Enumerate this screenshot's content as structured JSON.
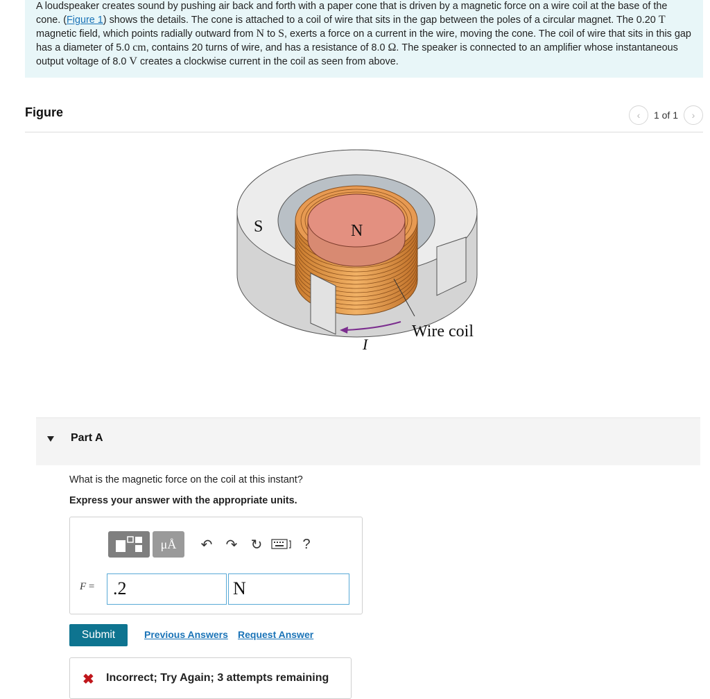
{
  "problem": {
    "s1": "A loudspeaker creates sound by pushing air back and forth with a paper cone that is driven by a magnetic force on a wire coil at the base of the cone. (",
    "figure_link": "Figure 1",
    "s2": ") shows the details. The cone is attached to a coil of wire that sits in the gap between the poles of a circular magnet. The 0.20 ",
    "sym_T": "T",
    "s3": " magnetic field, which points radially outward from ",
    "sym_N": "N",
    "s4": " to ",
    "sym_S": "S",
    "s5": ", exerts a force on a current in the wire, moving the cone. The coil of wire that sits in this gap has a diameter of 5.0 ",
    "sym_cm": "cm",
    "s6": ", contains 20 turns of wire, and has a resistance of 8.0 ",
    "sym_ohm": "Ω",
    "s7": ". The speaker is connected to an amplifier whose instantaneous output voltage of 8.0 ",
    "sym_V": "V",
    "s8": " creates a clockwise current in the coil as seen from above."
  },
  "figure": {
    "title": "Figure",
    "pager_text": "1 of 1",
    "label_S": "S",
    "label_N": "N",
    "label_coil": "Wire coil",
    "label_I": "I"
  },
  "part": {
    "title": "Part A",
    "question": "What is the magnetic force on the coil at this instant?",
    "instruction": "Express your answer with the appropriate units."
  },
  "toolbar": {
    "mu_label": "μÅ",
    "help_label": "?"
  },
  "answer": {
    "var_label": "F",
    "equals": " = ",
    "value": ".2",
    "unit": "N"
  },
  "actions": {
    "submit_label": "Submit",
    "previous_answers": "Previous Answers",
    "request_answer": "Request Answer"
  },
  "feedback": {
    "text": "Incorrect; Try Again; 3 attempts remaining"
  },
  "colors": {
    "accent": "#0e7490",
    "link": "#1a73b7",
    "problem_bg": "#e8f6f8",
    "error": "#c0161b"
  }
}
